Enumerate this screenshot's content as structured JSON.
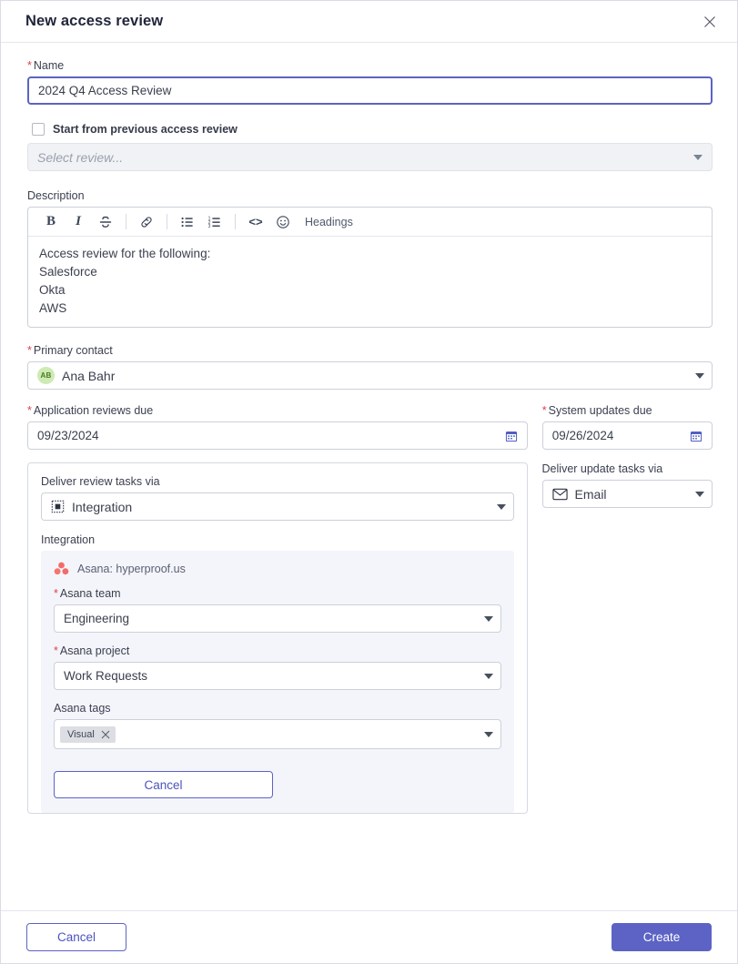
{
  "dialog": {
    "title": "New access review",
    "close_icon": "close-icon"
  },
  "name_field": {
    "label": "Name",
    "required": "*",
    "value": "2024 Q4 Access Review"
  },
  "previous_review": {
    "checkbox_label": "Start from previous access review",
    "select_placeholder": "Select review..."
  },
  "description": {
    "label": "Description",
    "toolbar": {
      "bold": "B",
      "italic": "I",
      "strikethrough": "S",
      "link": "link-icon",
      "bullet_list": "bullet-list-icon",
      "numbered_list": "numbered-list-icon",
      "code": "<>",
      "emoji": "emoji-icon",
      "headings": "Headings"
    },
    "content": "Access review for the following:\nSalesforce\nOkta\nAWS"
  },
  "primary_contact": {
    "label": "Primary contact",
    "required": "*",
    "avatar_initials": "AB",
    "value": "Ana Bahr"
  },
  "application_reviews_due": {
    "label": "Application reviews due",
    "required": "*",
    "value": "09/23/2024"
  },
  "system_updates_due": {
    "label": "System updates due",
    "required": "*",
    "value": "09/26/2024"
  },
  "deliver_review_tasks": {
    "label": "Deliver review tasks via",
    "value": "Integration",
    "icon": "integration-icon"
  },
  "deliver_update_tasks": {
    "label": "Deliver update tasks via",
    "value": "Email",
    "icon": "email-icon"
  },
  "integration": {
    "label": "Integration",
    "provider": "Asana: hyperproof.us",
    "team": {
      "label": "Asana team",
      "required": "*",
      "value": "Engineering"
    },
    "project": {
      "label": "Asana project",
      "required": "*",
      "value": "Work Requests"
    },
    "tags": {
      "label": "Asana tags",
      "chips": [
        "Visual"
      ]
    },
    "cancel_label": "Cancel"
  },
  "footer": {
    "cancel_label": "Cancel",
    "create_label": "Create"
  },
  "colors": {
    "accent": "#5c63c4",
    "required": "#e0414c",
    "asana": "#f06a6a",
    "panel_bg": "#f4f5fa",
    "avatar_bg": "#cdebb2"
  }
}
